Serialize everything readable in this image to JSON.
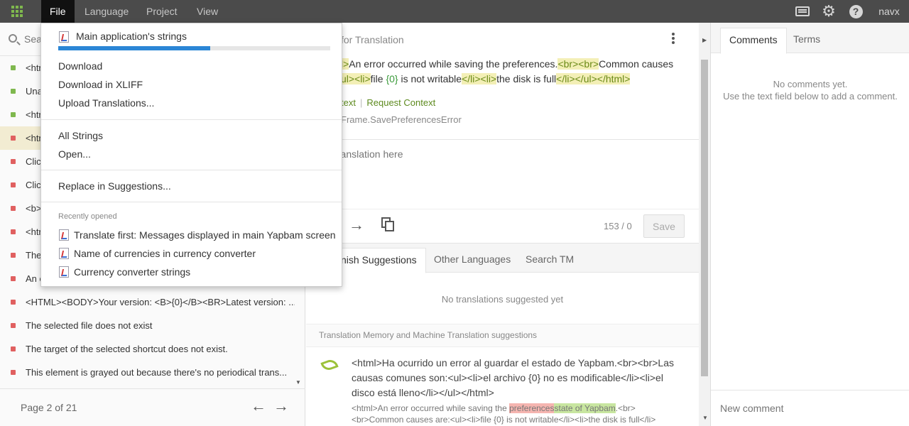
{
  "menubar": {
    "apps_icon": "apps-grid-icon",
    "tabs": [
      "File",
      "Language",
      "Project",
      "View"
    ],
    "user": "navx",
    "icons": [
      "keyboard-icon",
      "gear-icon",
      "help-icon"
    ],
    "help_glyph": "?"
  },
  "search": {
    "placeholder": "Sea"
  },
  "strings_list": [
    {
      "status": "translated",
      "text": "<htm"
    },
    {
      "status": "translated",
      "text": "Una"
    },
    {
      "status": "translated",
      "text": "<htm"
    },
    {
      "status": "untranslated",
      "text": "<htm"
    },
    {
      "status": "untranslated",
      "text": "Click"
    },
    {
      "status": "untranslated",
      "text": "Click"
    },
    {
      "status": "untranslated",
      "text": "<b>"
    },
    {
      "status": "untranslated",
      "text": "<htm"
    },
    {
      "status": "untranslated",
      "text": "The"
    },
    {
      "status": "untranslated",
      "text": "An e"
    },
    {
      "status": "untranslated",
      "text": "<HTML><BODY>Your version: <B>{0}</B><BR>Latest version: ..."
    },
    {
      "status": "untranslated",
      "text": "The selected file does not exist"
    },
    {
      "status": "untranslated",
      "text": "The target of the selected shortcut does not exist."
    },
    {
      "status": "untranslated",
      "text": "This element is grayed out because there's no periodical trans..."
    }
  ],
  "pager": {
    "label": "Page 2 of 21",
    "prev": "←",
    "next": "→"
  },
  "editor": {
    "title": "for Translation",
    "source_parts": [
      {
        "t": "l>",
        "c": "tag"
      },
      {
        "t": "An error occurred while saving the preferences.",
        "c": ""
      },
      {
        "t": "<br><br>",
        "c": "tag"
      },
      {
        "t": "Common causes ",
        "c": ""
      },
      {
        "t": "ul><li>",
        "c": "tag"
      },
      {
        "t": "file ",
        "c": ""
      },
      {
        "t": "{0}",
        "c": "ph"
      },
      {
        "t": " is not writable",
        "c": ""
      },
      {
        "t": "</li><li>",
        "c": "tag"
      },
      {
        "t": "the disk is full",
        "c": ""
      },
      {
        "t": "</li></ul></html>",
        "c": "tag"
      }
    ],
    "context_link": "text",
    "request_context": "Request Context",
    "string_key": "Frame.SavePreferencesError",
    "translation_placeholder": "translation here",
    "counter": "153 / 0",
    "save_label": "Save",
    "arrow": "→"
  },
  "suggestions": {
    "tabs": [
      "nish Suggestions",
      "Other Languages",
      "Search TM"
    ],
    "empty_text": "No translations suggested yet",
    "tm_header": "Translation Memory and Machine Translation suggestions",
    "tm_item": {
      "translation": "<html>Ha ocurrido un error al guardar el estado de Yapbam.<br><br>Las causas comunes son:<ul><li>el archivo {0} no es modificable</li><li>el disco está lleno</li></ul></html>",
      "source_before": "<html>An error occurred while saving the ",
      "source_deleted": "preferences",
      "source_inserted": "state of Yapbam",
      "source_after": ".<br><br>Common causes are:<ul><li>file {0} is not writable</li><li>the disk is full</li>"
    }
  },
  "comments": {
    "tabs": [
      "Comments",
      "Terms"
    ],
    "empty_line1": "No comments yet.",
    "empty_line2": "Use the text field below to add a comment.",
    "input_placeholder": "New comment"
  },
  "file_menu": {
    "main_item": "Main application's strings",
    "progress_fraction": 0.56,
    "items_group1": [
      "Download",
      "Download in XLIFF",
      "Upload Translations..."
    ],
    "items_group2": [
      "All Strings",
      "Open..."
    ],
    "items_group3": [
      "Replace in Suggestions..."
    ],
    "recent_label": "Recently opened",
    "recent": [
      "Translate first: Messages displayed in main Yapbam screen",
      "Name of currencies in currency converter",
      "Currency converter strings"
    ]
  },
  "colors": {
    "topbar": "#4b4b4b",
    "translated": "#7fb84e",
    "untranslated": "#e06060",
    "progress": "#2b86d6",
    "selected_row": "#f2ecd2"
  }
}
